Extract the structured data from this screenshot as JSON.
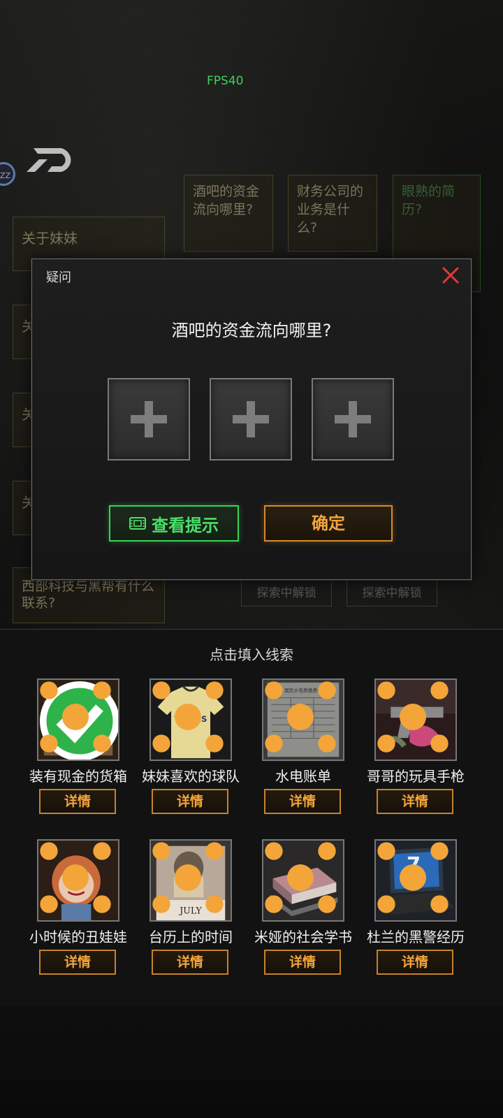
{
  "fps": "FPS40",
  "avatar": "ZZ",
  "background": {
    "top_cards": [
      "酒吧的资金流向哪里?",
      "财务公司的业务是什么?",
      "眼熟的简历?"
    ],
    "side_cards": [
      "关于妹妹",
      "关",
      "关",
      "关",
      "西部科技与黑帮有什么联系?"
    ],
    "locked": [
      "探索中解锁",
      "探索中解锁"
    ]
  },
  "dialog": {
    "title": "疑问",
    "question": "酒吧的资金流向哪里?",
    "hint_label": "查看提示",
    "confirm_label": "确定",
    "colors": {
      "hint": "#3bd35a",
      "confirm": "#f3a53a",
      "close": "#e03a3a"
    }
  },
  "clue_panel": {
    "title": "点击填入线索",
    "detail_label": "详情",
    "items": [
      {
        "name": "装有现金的货箱",
        "icon": "cash-crate-image",
        "checked": true
      },
      {
        "name": "妹妹喜欢的球队",
        "icon": "jersey-image",
        "checked": false
      },
      {
        "name": "水电账单",
        "icon": "utility-bill-image",
        "checked": false
      },
      {
        "name": "哥哥的玩具手枪",
        "icon": "toy-gun-image",
        "checked": false
      },
      {
        "name": "小时候的丑娃娃",
        "icon": "ugly-doll-image",
        "checked": false
      },
      {
        "name": "台历上的时间",
        "icon": "desk-calendar-image",
        "checked": false
      },
      {
        "name": "米娅的社会学书",
        "icon": "sociology-book-image",
        "checked": false
      },
      {
        "name": "杜兰的黑警经历",
        "icon": "laptop-image",
        "checked": false
      }
    ]
  },
  "bill_text": "居民水电费缴费单",
  "jersey_text": "TIGRES",
  "calendar_text": "JULY",
  "laptop_number": "7"
}
